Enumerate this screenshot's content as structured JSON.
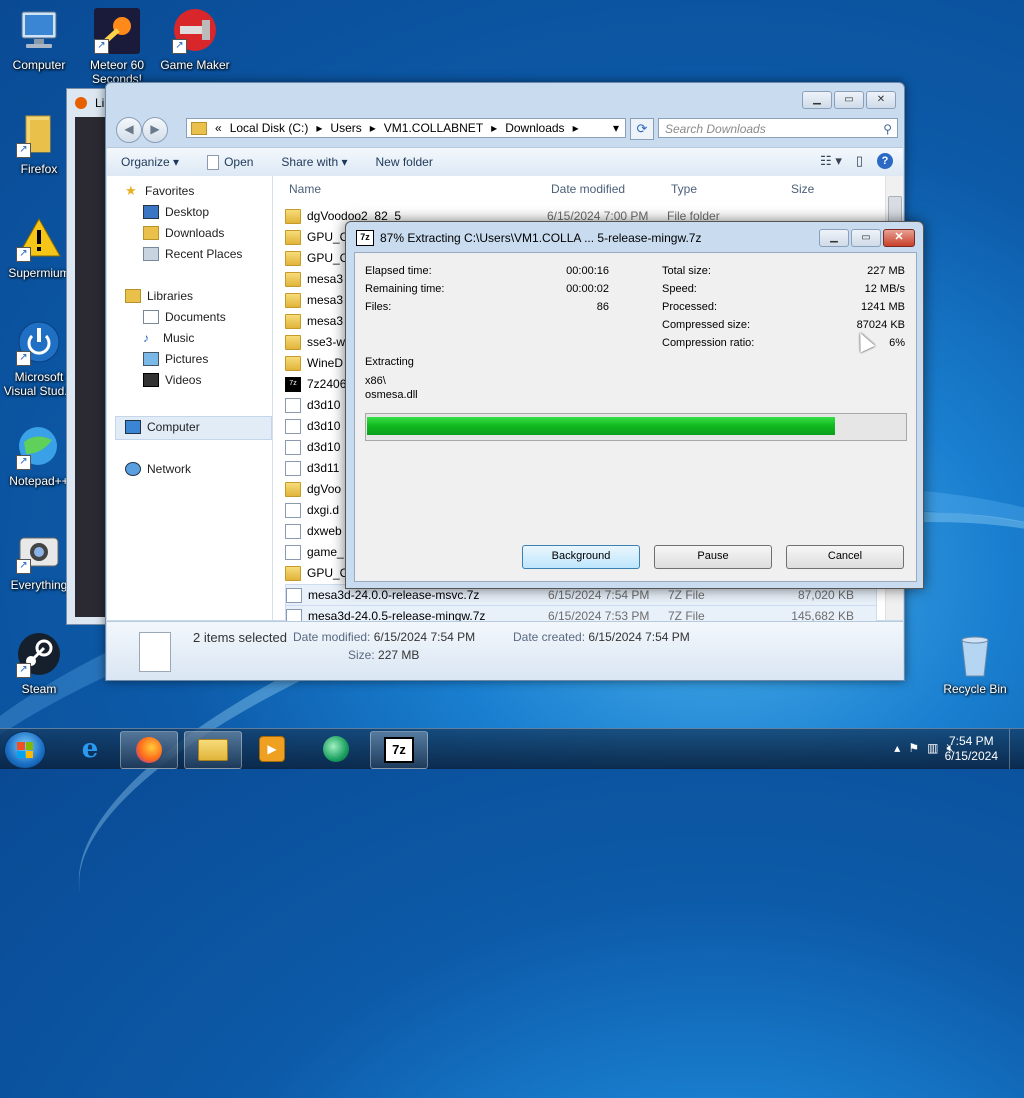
{
  "desktop": {
    "icons": [
      {
        "label": "Computer"
      },
      {
        "label": "Meteor 60 Seconds!"
      },
      {
        "label": "Game Maker"
      },
      {
        "label": "Firefox"
      },
      {
        "label": "Supermium"
      },
      {
        "label": "Microsoft Visual Stud..."
      },
      {
        "label": "Notepad++"
      },
      {
        "label": "Everything"
      },
      {
        "label": "Steam"
      },
      {
        "label": "Recycle Bin"
      }
    ]
  },
  "firefox_window": {
    "title_fragment": "Li"
  },
  "explorer": {
    "breadcrumb": [
      "«",
      "Local Disk (C:)",
      "Users",
      "VM1.COLLABNET",
      "Downloads"
    ],
    "search_placeholder": "Search Downloads",
    "toolbar": {
      "organize": "Organize ▾",
      "open": "Open",
      "share_with": "Share with ▾",
      "new_folder": "New folder"
    },
    "nav": {
      "favorites": "Favorites",
      "desktop": "Desktop",
      "downloads": "Downloads",
      "recent_places": "Recent Places",
      "libraries": "Libraries",
      "documents": "Documents",
      "music": "Music",
      "pictures": "Pictures",
      "videos": "Videos",
      "computer": "Computer",
      "network": "Network"
    },
    "columns": {
      "name": "Name",
      "date": "Date modified",
      "type": "Type",
      "size": "Size"
    },
    "files": [
      {
        "name": "dgVoodoo2_82_5",
        "date": "6/15/2024 7:00 PM",
        "type": "File folder",
        "size": "",
        "icon": "folder"
      },
      {
        "name": "GPU_C",
        "date": "",
        "type": "",
        "size": "",
        "icon": "folder"
      },
      {
        "name": "GPU_C",
        "date": "",
        "type": "",
        "size": "",
        "icon": "folder"
      },
      {
        "name": "mesa3",
        "date": "",
        "type": "",
        "size": "",
        "icon": "folder"
      },
      {
        "name": "mesa3",
        "date": "",
        "type": "",
        "size": "",
        "icon": "folder"
      },
      {
        "name": "mesa3",
        "date": "",
        "type": "",
        "size": "",
        "icon": "folder"
      },
      {
        "name": "sse3-w",
        "date": "",
        "type": "",
        "size": "",
        "icon": "folder"
      },
      {
        "name": "WineD",
        "date": "",
        "type": "",
        "size": "",
        "icon": "folder"
      },
      {
        "name": "7z2406",
        "date": "",
        "type": "",
        "size": "",
        "icon": "7z"
      },
      {
        "name": "d3d10",
        "date": "",
        "type": "",
        "size": "",
        "icon": "doc"
      },
      {
        "name": "d3d10",
        "date": "",
        "type": "",
        "size": "",
        "icon": "doc"
      },
      {
        "name": "d3d10",
        "date": "",
        "type": "",
        "size": "",
        "icon": "doc"
      },
      {
        "name": "d3d11",
        "date": "",
        "type": "",
        "size": "",
        "icon": "doc"
      },
      {
        "name": "dgVoo",
        "date": "",
        "type": "",
        "size": "",
        "icon": "folder"
      },
      {
        "name": "dxgi.d",
        "date": "",
        "type": "",
        "size": "",
        "icon": "doc"
      },
      {
        "name": "dxweb",
        "date": "",
        "type": "",
        "size": "",
        "icon": "doc"
      },
      {
        "name": "game_",
        "date": "",
        "type": "",
        "size": "",
        "icon": "doc"
      },
      {
        "name": "GPU_C",
        "date": "",
        "type": "",
        "size": "",
        "icon": "folder"
      },
      {
        "name": "mesa3d-24.0.0-release-msvc.7z",
        "date": "6/15/2024 7:54 PM",
        "type": "7Z File",
        "size": "87,020 KB",
        "icon": "doc"
      },
      {
        "name": "mesa3d-24.0.5-release-mingw.7z",
        "date": "6/15/2024 7:53 PM",
        "type": "7Z File",
        "size": "145,682 KB",
        "icon": "doc"
      }
    ],
    "details": {
      "selected": "2 items selected",
      "date_modified_label": "Date modified:",
      "date_modified": "6/15/2024 7:54 PM",
      "date_created_label": "Date created:",
      "date_created": "6/15/2024 7:54 PM",
      "size_label": "Size:",
      "size": "227 MB"
    }
  },
  "zip_dialog": {
    "title": "87% Extracting C:\\Users\\VM1.COLLA ... 5-release-mingw.7z",
    "elapsed_label": "Elapsed time:",
    "elapsed": "00:00:16",
    "remaining_label": "Remaining time:",
    "remaining": "00:00:02",
    "files_label": "Files:",
    "files": "86",
    "total_label": "Total size:",
    "total": "227 MB",
    "speed_label": "Speed:",
    "speed": "12 MB/s",
    "processed_label": "Processed:",
    "processed": "1241 MB",
    "compressed_label": "Compressed size:",
    "compressed": "87024 KB",
    "ratio_label": "Compression ratio:",
    "ratio": "6%",
    "extracting_label": "Extracting",
    "path1": "x86\\",
    "path2": "osmesa.dll",
    "progress_percent": 87,
    "buttons": {
      "background": "Background",
      "pause": "Pause",
      "cancel": "Cancel"
    }
  },
  "taskbar": {
    "time": "7:54 PM",
    "date": "6/15/2024"
  }
}
